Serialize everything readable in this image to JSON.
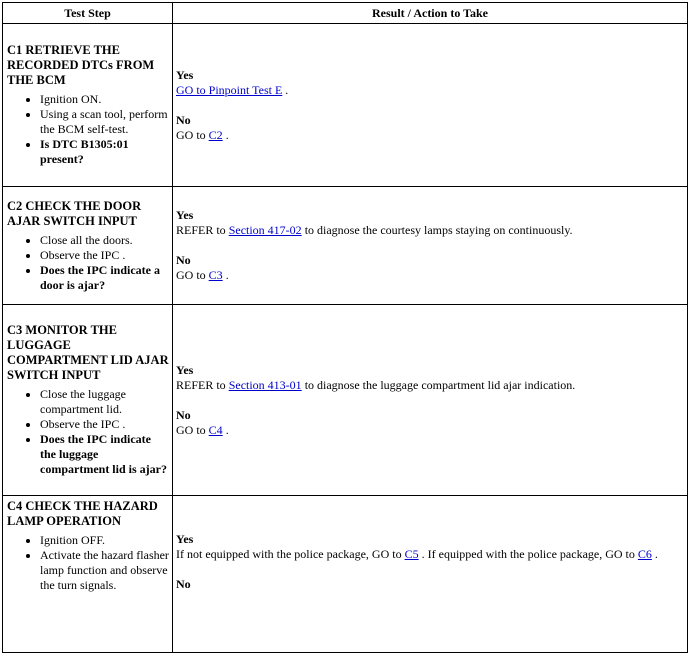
{
  "headers": {
    "test_step": "Test Step",
    "result": "Result / Action to Take"
  },
  "rows": [
    {
      "title": "C1 RETRIEVE THE RECORDED DTCs FROM THE BCM",
      "bullets": [
        "Ignition ON.",
        "Using a scan tool, perform the BCM self-test."
      ],
      "question": "Is DTC B1305:01 present?",
      "yes_label": "Yes",
      "yes_link": "GO to Pinpoint Test E",
      "yes_after": " .",
      "no_label": "No",
      "no_prefix": "GO to ",
      "no_link": "C2",
      "no_after": " ."
    },
    {
      "title": "C2 CHECK THE DOOR AJAR SWITCH INPUT",
      "bullets": [
        "Close all the doors.",
        "Observe the IPC ."
      ],
      "question": "Does the IPC indicate a door is ajar?",
      "yes_label": "Yes",
      "yes_prefix": "REFER to ",
      "yes_link": "Section 417-02",
      "yes_after": " to diagnose the courtesy lamps staying on continuously.",
      "no_label": "No",
      "no_prefix": "GO to ",
      "no_link": "C3",
      "no_after": " ."
    },
    {
      "title": "C3 MONITOR THE LUGGAGE COMPARTMENT LID AJAR SWITCH INPUT",
      "bullets": [
        "Close the luggage compartment lid.",
        "Observe the IPC ."
      ],
      "question": "Does the IPC indicate the luggage compartment lid is ajar?",
      "yes_label": "Yes",
      "yes_prefix": "REFER to ",
      "yes_link": "Section 413-01",
      "yes_after": " to diagnose the luggage compartment lid ajar indication.",
      "no_label": "No",
      "no_prefix": "GO to ",
      "no_link": "C4",
      "no_after": " ."
    },
    {
      "title": "C4 CHECK THE HAZARD LAMP OPERATION",
      "bullets": [
        "Ignition OFF.",
        "Activate the hazard flasher lamp function and observe the turn signals."
      ],
      "yes_label": "Yes",
      "yes_prefix": "If not equipped with the police package, GO to ",
      "yes_link": "C5",
      "yes_mid": " . If equipped with the police package, GO to ",
      "yes_link2": "C6",
      "yes_after": " .",
      "no_label": "No"
    }
  ]
}
